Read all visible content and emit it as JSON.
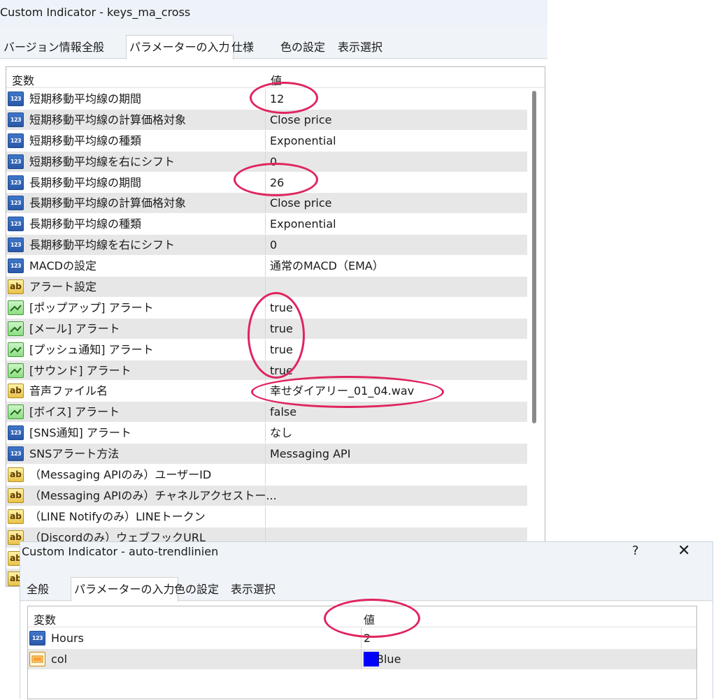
{
  "window1": {
    "title": "Custom Indicator - keys_ma_cross",
    "tabs": [
      "バージョン情報",
      "全般",
      "パラメーターの入力",
      "仕様",
      "色の設定",
      "表示選択"
    ],
    "active_tab": "パラメーターの入力",
    "header": {
      "name": "変数",
      "value": "値"
    },
    "rows": [
      {
        "icon": "number-icon",
        "name": "短期移動平均線の期間",
        "value": "12"
      },
      {
        "icon": "number-icon",
        "name": "短期移動平均線の計算価格対象",
        "value": "Close price"
      },
      {
        "icon": "number-icon",
        "name": "短期移動平均線の種類",
        "value": "Exponential"
      },
      {
        "icon": "number-icon",
        "name": "短期移動平均線を右にシフト",
        "value": "0"
      },
      {
        "icon": "number-icon",
        "name": "長期移動平均線の期間",
        "value": "26"
      },
      {
        "icon": "number-icon",
        "name": "長期移動平均線の計算価格対象",
        "value": "Close price"
      },
      {
        "icon": "number-icon",
        "name": "長期移動平均線の種類",
        "value": "Exponential"
      },
      {
        "icon": "number-icon",
        "name": "長期移動平均線を右にシフト",
        "value": "0"
      },
      {
        "icon": "number-icon",
        "name": "MACDの設定",
        "value": "通常のMACD（EMA）"
      },
      {
        "icon": "string-icon",
        "name": "アラート設定",
        "value": ""
      },
      {
        "icon": "bool-icon",
        "name": "[ポップアップ] アラート",
        "value": "true"
      },
      {
        "icon": "bool-icon",
        "name": "[メール] アラート",
        "value": "true"
      },
      {
        "icon": "bool-icon",
        "name": "[プッシュ通知] アラート",
        "value": "true"
      },
      {
        "icon": "bool-icon",
        "name": "[サウンド] アラート",
        "value": "true"
      },
      {
        "icon": "string-icon",
        "name": "音声ファイル名",
        "value": "幸せダイアリー_01_04.wav"
      },
      {
        "icon": "bool-icon",
        "name": "[ボイス] アラート",
        "value": "false"
      },
      {
        "icon": "number-icon",
        "name": "[SNS通知] アラート",
        "value": "なし"
      },
      {
        "icon": "number-icon",
        "name": "SNSアラート方法",
        "value": "Messaging API"
      },
      {
        "icon": "string-icon",
        "name": "（Messaging APIのみ）ユーザーID",
        "value": ""
      },
      {
        "icon": "string-icon",
        "name": "（Messaging APIのみ）チャネルアクセストー...",
        "value": ""
      },
      {
        "icon": "string-icon",
        "name": "（LINE Notifyのみ）LINEトークン",
        "value": ""
      },
      {
        "icon": "string-icon",
        "name": "（Discordのみ）ウェブフックURL",
        "value": ""
      },
      {
        "icon": "string-icon",
        "name": "",
        "value": ""
      },
      {
        "icon": "string-icon",
        "name": "",
        "value": ""
      }
    ]
  },
  "window2": {
    "title": "Custom Indicator - auto-trendlinien",
    "help_label": "?",
    "close_label": "✕",
    "tabs": [
      "全般",
      "パラメーターの入力",
      "色の設定",
      "表示選択"
    ],
    "active_tab": "パラメーターの入力",
    "header": {
      "name": "変数",
      "value": "値"
    },
    "rows": [
      {
        "icon": "number-icon",
        "name": "Hours",
        "value": "2"
      },
      {
        "icon": "color-icon",
        "name": "col",
        "value": "Blue",
        "swatch": "#0000ff"
      }
    ]
  },
  "colors": {
    "annotation": "#e0245e",
    "row_alt": "#e7e7e7",
    "number_icon": "#2f63b5",
    "string_icon": "#e8c24a",
    "bool_icon": "#8fdc84"
  }
}
